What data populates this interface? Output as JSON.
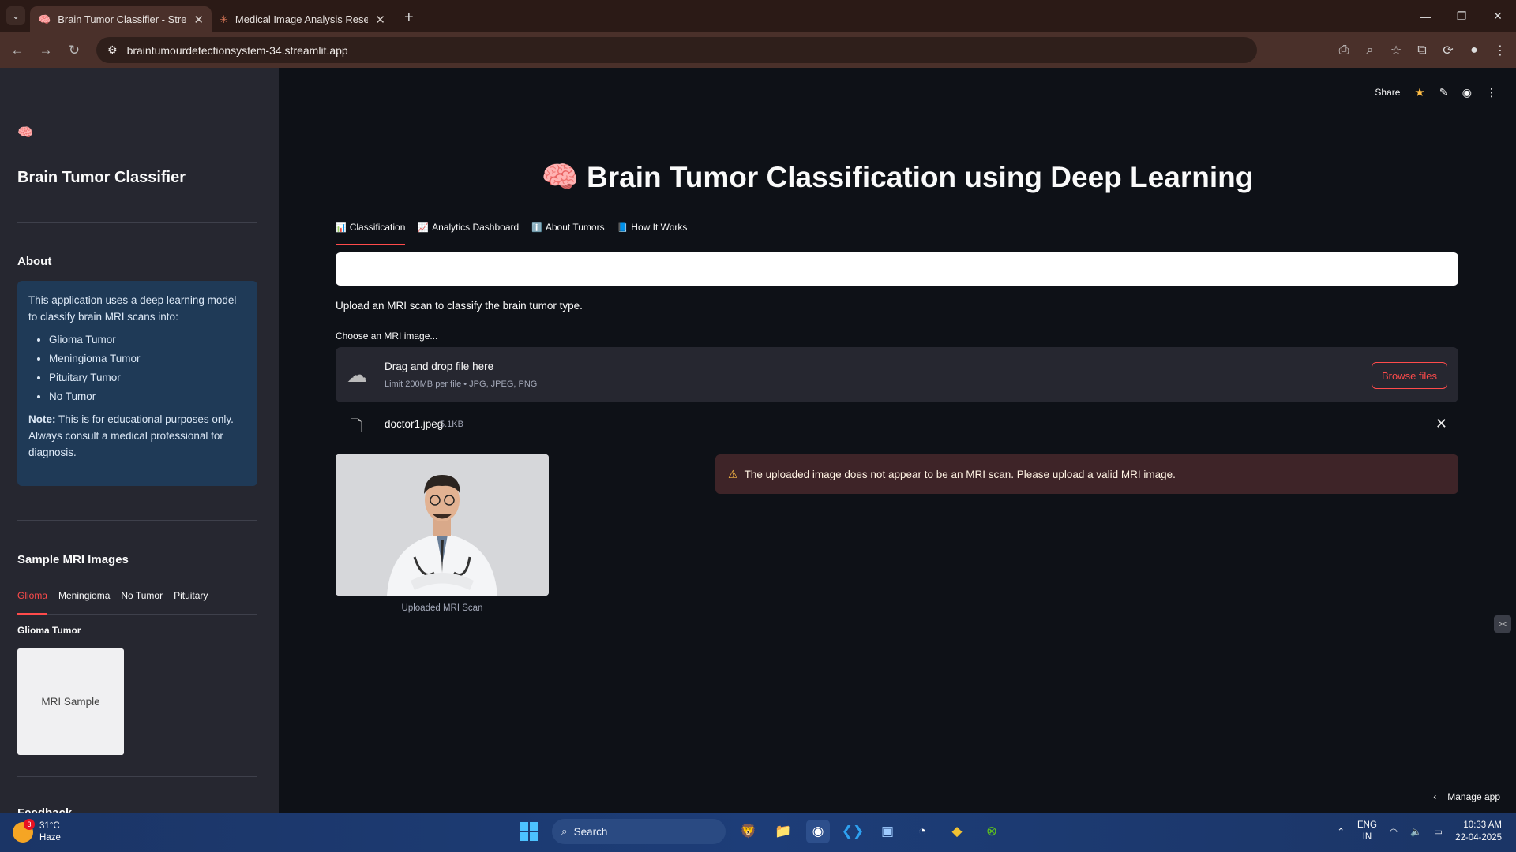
{
  "browser": {
    "tabs": [
      {
        "title": "Brain Tumor Classifier - Streamlit",
        "icon": "brain-favicon"
      },
      {
        "title": "Medical Image Analysis Research",
        "icon": "claude-favicon"
      }
    ],
    "url": "braintumourdetectionsystem-34.streamlit.app"
  },
  "sidebar": {
    "logo": "🧠",
    "title": "Brain Tumor Classifier",
    "about_heading": "About",
    "about_intro": "This application uses a deep learning model to classify brain MRI scans into:",
    "classes": [
      "Glioma Tumor",
      "Meningioma Tumor",
      "Pituitary Tumor",
      "No Tumor"
    ],
    "note_label": "Note:",
    "note_text": " This is for educational purposes only. Always consult a medical professional for diagnosis.",
    "samples_heading": "Sample MRI Images",
    "sample_tabs": [
      "Glioma",
      "Meningioma",
      "No Tumor",
      "Pituitary"
    ],
    "active_sample_tab": "Glioma",
    "sample_subheading": "Glioma Tumor",
    "sample_placeholder": "MRI Sample",
    "next_heading": "Feedback"
  },
  "header": {
    "share": "Share"
  },
  "main": {
    "title_emoji": "🧠",
    "title": "Brain Tumor Classification using Deep Learning",
    "tabs": [
      {
        "icon": "📊",
        "label": "Classification"
      },
      {
        "icon": "📈",
        "label": "Analytics Dashboard"
      },
      {
        "icon": "ℹ️",
        "label": "About Tumors"
      },
      {
        "icon": "📘",
        "label": "How It Works"
      }
    ],
    "active_tab": "Classification",
    "caption": "Upload an MRI scan to classify the brain tumor type.",
    "uploader_label": "Choose an MRI image...",
    "drop_title": "Drag and drop file here",
    "drop_limit": "Limit 200MB per file • JPG, JPEG, PNG",
    "browse_label": "Browse files",
    "file_name": "doctor1.jpeg",
    "file_size": "5.1KB",
    "image_caption": "Uploaded MRI Scan",
    "warning": "The uploaded image does not appear to be an MRI scan. Please upload a valid MRI image.",
    "manage_app": "Manage app"
  },
  "taskbar": {
    "temperature": "31°C",
    "condition": "Haze",
    "weather_badge": "3",
    "search_placeholder": "Search",
    "lang_top": "ENG",
    "lang_bottom": "IN",
    "time": "10:33 AM",
    "date": "22-04-2025"
  }
}
